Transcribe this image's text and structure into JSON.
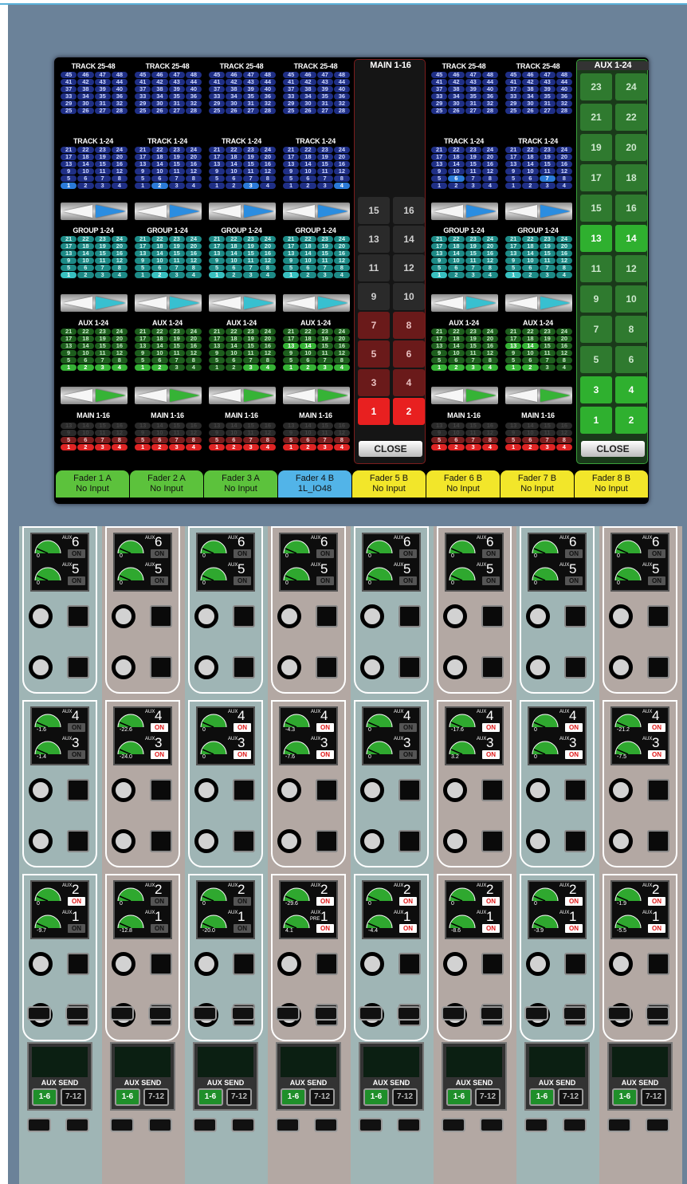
{
  "labels": {
    "track_hi": "TRACK 25-48",
    "track_lo": "TRACK 1-24",
    "group": "GROUP 1-24",
    "aux": "AUX 1-24",
    "main": "MAIN 1-16",
    "close": "CLOSE",
    "aux_word": "AUX",
    "pre_word": "PRE",
    "on": "ON",
    "aux_send": "AUX SEND",
    "send_a": "1-6",
    "send_b": "7-12"
  },
  "colors": {
    "blue": "#2a7ad8",
    "teal": "#38c0c0",
    "green": "#36b336",
    "red": "#e02424",
    "yellow": "#f2e62a",
    "fader_green": "#5cc23c",
    "fader_blue": "#52b4e8"
  },
  "faders": [
    {
      "name": "Fader 1 A",
      "input": "No Input",
      "color": "green",
      "track_sel": 1,
      "group_sel": 1,
      "aux_sel": [
        1,
        2,
        3,
        4
      ],
      "main_sel": [
        1,
        2,
        3,
        4
      ]
    },
    {
      "name": "Fader 2 A",
      "input": "No Input",
      "color": "green",
      "track_sel": 2,
      "group_sel": 2,
      "aux_sel": [
        1,
        2
      ],
      "main_sel": [
        1,
        2,
        3,
        4
      ]
    },
    {
      "name": "Fader 3 A",
      "input": "No Input",
      "color": "green",
      "track_sel": 3,
      "group_sel": 1,
      "aux_sel": [
        3,
        4
      ],
      "main_sel": [
        1,
        2,
        3,
        4
      ]
    },
    {
      "name": "Fader 4 B",
      "input": "1L_IO48",
      "color": "blue",
      "track_sel": 4,
      "group_sel": 1,
      "aux_sel": [
        1,
        2,
        3,
        4,
        13,
        14
      ],
      "main_sel": [
        1,
        2,
        3,
        4
      ]
    },
    {
      "name": "Fader 5 B",
      "input": "No Input",
      "color": "yellow"
    },
    {
      "name": "Fader 6 B",
      "input": "No Input",
      "color": "yellow",
      "track_sel": 6,
      "group_sel": 1,
      "aux_sel": [
        1,
        2,
        3,
        4
      ],
      "main_sel": [
        1,
        2,
        3,
        4
      ]
    },
    {
      "name": "Fader 7 B",
      "input": "No Input",
      "color": "yellow",
      "track_sel": 7,
      "group_sel": 1,
      "aux_sel": [
        1,
        2,
        13,
        14
      ],
      "main_sel": [
        1,
        2,
        3,
        4
      ]
    },
    {
      "name": "Fader 8 B",
      "input": "No Input",
      "color": "yellow"
    }
  ],
  "main_panel": {
    "title": "MAIN 1-16",
    "rows": [
      [
        15,
        16
      ],
      [
        13,
        14
      ],
      [
        11,
        12
      ],
      [
        9,
        10
      ],
      [
        7,
        8
      ],
      [
        5,
        6
      ],
      [
        3,
        4
      ],
      [
        1,
        2
      ]
    ]
  },
  "aux_panel": {
    "title": "AUX 1-24",
    "rows": [
      [
        23,
        24
      ],
      [
        21,
        22
      ],
      [
        19,
        20
      ],
      [
        17,
        18
      ],
      [
        15,
        16
      ],
      [
        13,
        14
      ],
      [
        11,
        12
      ],
      [
        9,
        10
      ],
      [
        7,
        8
      ],
      [
        5,
        6
      ],
      [
        3,
        4
      ],
      [
        1,
        2
      ]
    ],
    "selected": [
      13,
      14,
      3,
      4,
      1,
      2
    ]
  },
  "strips": [
    {
      "aux": [
        {
          "n": "6",
          "v": "0",
          "on": false
        },
        {
          "n": "5",
          "v": "0",
          "on": false
        },
        {
          "n": "4",
          "v": "-1.6",
          "on": false
        },
        {
          "n": "3",
          "v": "-1.4",
          "on": false
        },
        {
          "n": "2",
          "v": "0",
          "on": true
        },
        {
          "n": "1",
          "v": "-9.7",
          "on": false
        }
      ]
    },
    {
      "aux": [
        {
          "n": "6",
          "v": "0",
          "on": false
        },
        {
          "n": "5",
          "v": "0",
          "on": false
        },
        {
          "n": "4",
          "v": "-22.6",
          "on": true
        },
        {
          "n": "3",
          "v": "-24.0",
          "on": true
        },
        {
          "n": "2",
          "v": "0",
          "on": false
        },
        {
          "n": "1",
          "v": "-12.8",
          "on": false
        }
      ]
    },
    {
      "aux": [
        {
          "n": "6",
          "v": "0",
          "on": false
        },
        {
          "n": "5",
          "v": "0",
          "on": false
        },
        {
          "n": "4",
          "v": "0",
          "on": true
        },
        {
          "n": "3",
          "v": "0",
          "on": true
        },
        {
          "n": "2",
          "v": "0",
          "on": false
        },
        {
          "n": "1",
          "v": "-20.0",
          "on": false
        }
      ]
    },
    {
      "aux": [
        {
          "n": "6",
          "v": "0",
          "on": false
        },
        {
          "n": "5",
          "v": "0",
          "on": false
        },
        {
          "n": "4",
          "v": "-4.3",
          "on": true
        },
        {
          "n": "3",
          "v": "-7.6",
          "on": true
        },
        {
          "n": "2",
          "v": "-29.6",
          "on": true
        },
        {
          "n": "1",
          "v": "4.1",
          "on": true,
          "pre": true
        }
      ]
    },
    {
      "aux": [
        {
          "n": "6",
          "v": "0",
          "on": false
        },
        {
          "n": "5",
          "v": "0",
          "on": false
        },
        {
          "n": "4",
          "v": "0",
          "on": false
        },
        {
          "n": "3",
          "v": "0",
          "on": false
        },
        {
          "n": "2",
          "v": "0",
          "on": true
        },
        {
          "n": "1",
          "v": "-4.4",
          "on": true
        }
      ]
    },
    {
      "aux": [
        {
          "n": "6",
          "v": "0",
          "on": false
        },
        {
          "n": "5",
          "v": "0",
          "on": false
        },
        {
          "n": "4",
          "v": "-17.6",
          "on": true
        },
        {
          "n": "3",
          "v": "3.2",
          "on": true
        },
        {
          "n": "2",
          "v": "0",
          "on": true
        },
        {
          "n": "1",
          "v": "-8.6",
          "on": true
        }
      ]
    },
    {
      "aux": [
        {
          "n": "6",
          "v": "0",
          "on": false
        },
        {
          "n": "5",
          "v": "0",
          "on": false
        },
        {
          "n": "4",
          "v": "0",
          "on": true
        },
        {
          "n": "3",
          "v": "0",
          "on": true
        },
        {
          "n": "2",
          "v": "0",
          "on": true
        },
        {
          "n": "1",
          "v": "-3.9",
          "on": true
        }
      ]
    },
    {
      "aux": [
        {
          "n": "6",
          "v": "0",
          "on": false
        },
        {
          "n": "5",
          "v": "0",
          "on": false
        },
        {
          "n": "4",
          "v": "-21.2",
          "on": true
        },
        {
          "n": "3",
          "v": "-7.5",
          "on": true
        },
        {
          "n": "2",
          "v": "-1.9",
          "on": true
        },
        {
          "n": "1",
          "v": "-5.5",
          "on": true
        }
      ]
    }
  ]
}
